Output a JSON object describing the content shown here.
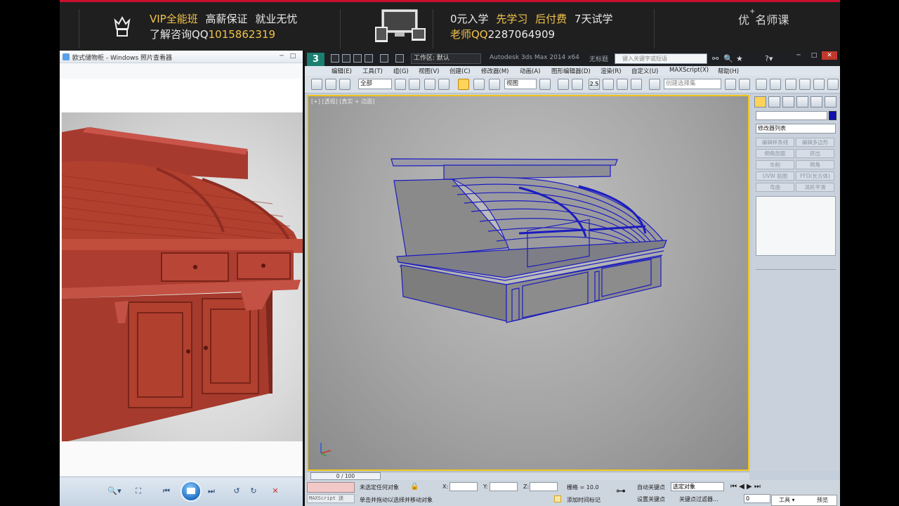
{
  "banner": {
    "vip_label": "VIP全能班",
    "guarantee": "高薪保证",
    "employment": "就业无忧",
    "consult_prefix": "了解咨询QQ",
    "consult_qq": "1015862319",
    "zero_fee": "0元入学",
    "learn_first": "先学习",
    "pay_later": "后付费",
    "trial": "7天试学",
    "teacher_prefix": "老师QQ",
    "teacher_qq": "2287064909",
    "brand_prefix": "优",
    "brand_plus": "+",
    "brand_suffix": "名师课"
  },
  "viewer": {
    "title": "欧式储物柜 - Windows 照片查看器",
    "min": "─",
    "max": "□",
    "zoom_icon": "🔍▾",
    "fit_icon": "⛶",
    "prev_icon": "⏮",
    "next_icon": "⏭",
    "rotl_icon": "↺",
    "rotr_icon": "↻",
    "delete_icon": "✕"
  },
  "max": {
    "logo": "3",
    "workspace": "工作区: 默认",
    "app_title": "Autodesk 3ds Max  2014 x64",
    "file_title": "无标题",
    "search_placeholder": "键入关键字或短语",
    "win_min": "─",
    "win_max": "□",
    "win_close": "✕",
    "title_icons": [
      "⚯",
      "🔍",
      "★",
      "?▾"
    ],
    "menu": [
      "编辑(E)",
      "工具(T)",
      "组(G)",
      "视图(V)",
      "创建(C)",
      "修改器(M)",
      "动画(A)",
      "图形编辑器(D)",
      "渲染(R)",
      "自定义(U)",
      "MAXScript(X)",
      "帮助(H)"
    ],
    "toolbar": {
      "filter": "全部",
      "ref_coord": "视图",
      "snap_value": "2.5",
      "named_sel": "创建选择集"
    },
    "viewport_label": "[+] [透视] [真实 + 边面]",
    "command_panel": {
      "modifier_list": "修改器列表",
      "buttons": [
        "编辑样条线",
        "编辑多边形",
        "倒角剖面",
        "挤出",
        "车削",
        "倒角",
        "UVW 贴图",
        "FFD(长方体)",
        "弯曲",
        "涡轮平滑"
      ]
    },
    "timeline": {
      "slider": "0 / 100"
    },
    "status": {
      "sel_info": "未选定任何对象",
      "prompt": "单击并拖动以选择并移动对象",
      "x_label": "X:",
      "y_label": "Y:",
      "z_label": "Z:",
      "grid": "栅格 = 10.0",
      "add_time_tag": "添加时间标记",
      "auto_key": "自动关键点",
      "set_key": "设置关键点",
      "key_filter_sel": "选定对象",
      "key_filters": "关键点过滤器...",
      "frame": "0",
      "maxscript": "MAXScript 迷"
    },
    "tray": {
      "tools": "工具 ▾",
      "preview": "预览"
    }
  },
  "colors": {
    "banner_bg": "#1f1f1f",
    "banner_accent": "#c8102e",
    "highlight_gold": "#f1c34b",
    "viewport_border": "#f0c419",
    "wireframe": "#1c1cc0",
    "cabinet": "#b03a2e"
  }
}
